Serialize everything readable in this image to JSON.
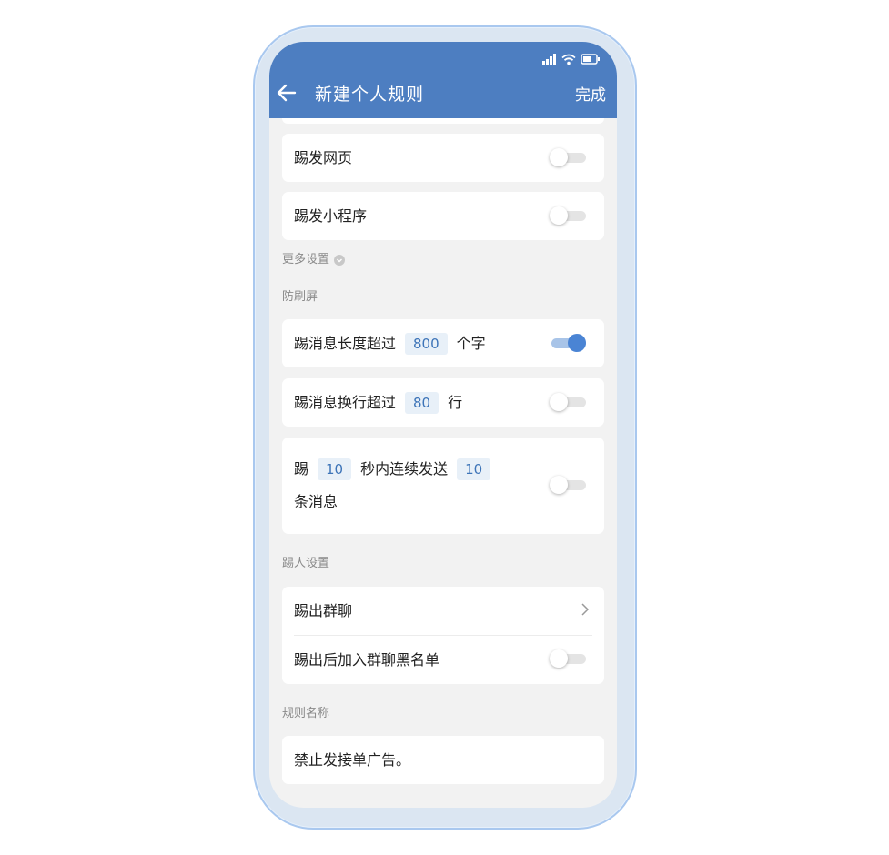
{
  "header": {
    "title": "新建个人规则",
    "done_label": "完成"
  },
  "rows": {
    "kick_webpage": {
      "label": "踢发网页",
      "on": false
    },
    "kick_miniprogram": {
      "label": "踢发小程序",
      "on": false
    }
  },
  "more_settings": {
    "label": "更多设置"
  },
  "anti_spam": {
    "section_label": "防刷屏",
    "length": {
      "prefix": "踢消息长度超过",
      "value": "800",
      "suffix": "个字",
      "on": true
    },
    "lines": {
      "prefix": "踢消息换行超过",
      "value": "80",
      "suffix": "行",
      "on": false
    },
    "burst": {
      "prefix": "踢",
      "seconds": "10",
      "middle": "秒内连续发送",
      "count": "10",
      "suffix": "条消息",
      "on": false
    }
  },
  "kick_settings": {
    "section_label": "踢人设置",
    "kick_group": {
      "label": "踢出群聊"
    },
    "blacklist": {
      "label": "踢出后加入群聊黑名单",
      "on": false
    }
  },
  "rule_name": {
    "section_label": "规则名称",
    "value": "禁止发接单广告。"
  },
  "colors": {
    "header_bg": "#4d7ec1",
    "accent": "#4a84d4",
    "page_bg": "#f2f2f2"
  }
}
